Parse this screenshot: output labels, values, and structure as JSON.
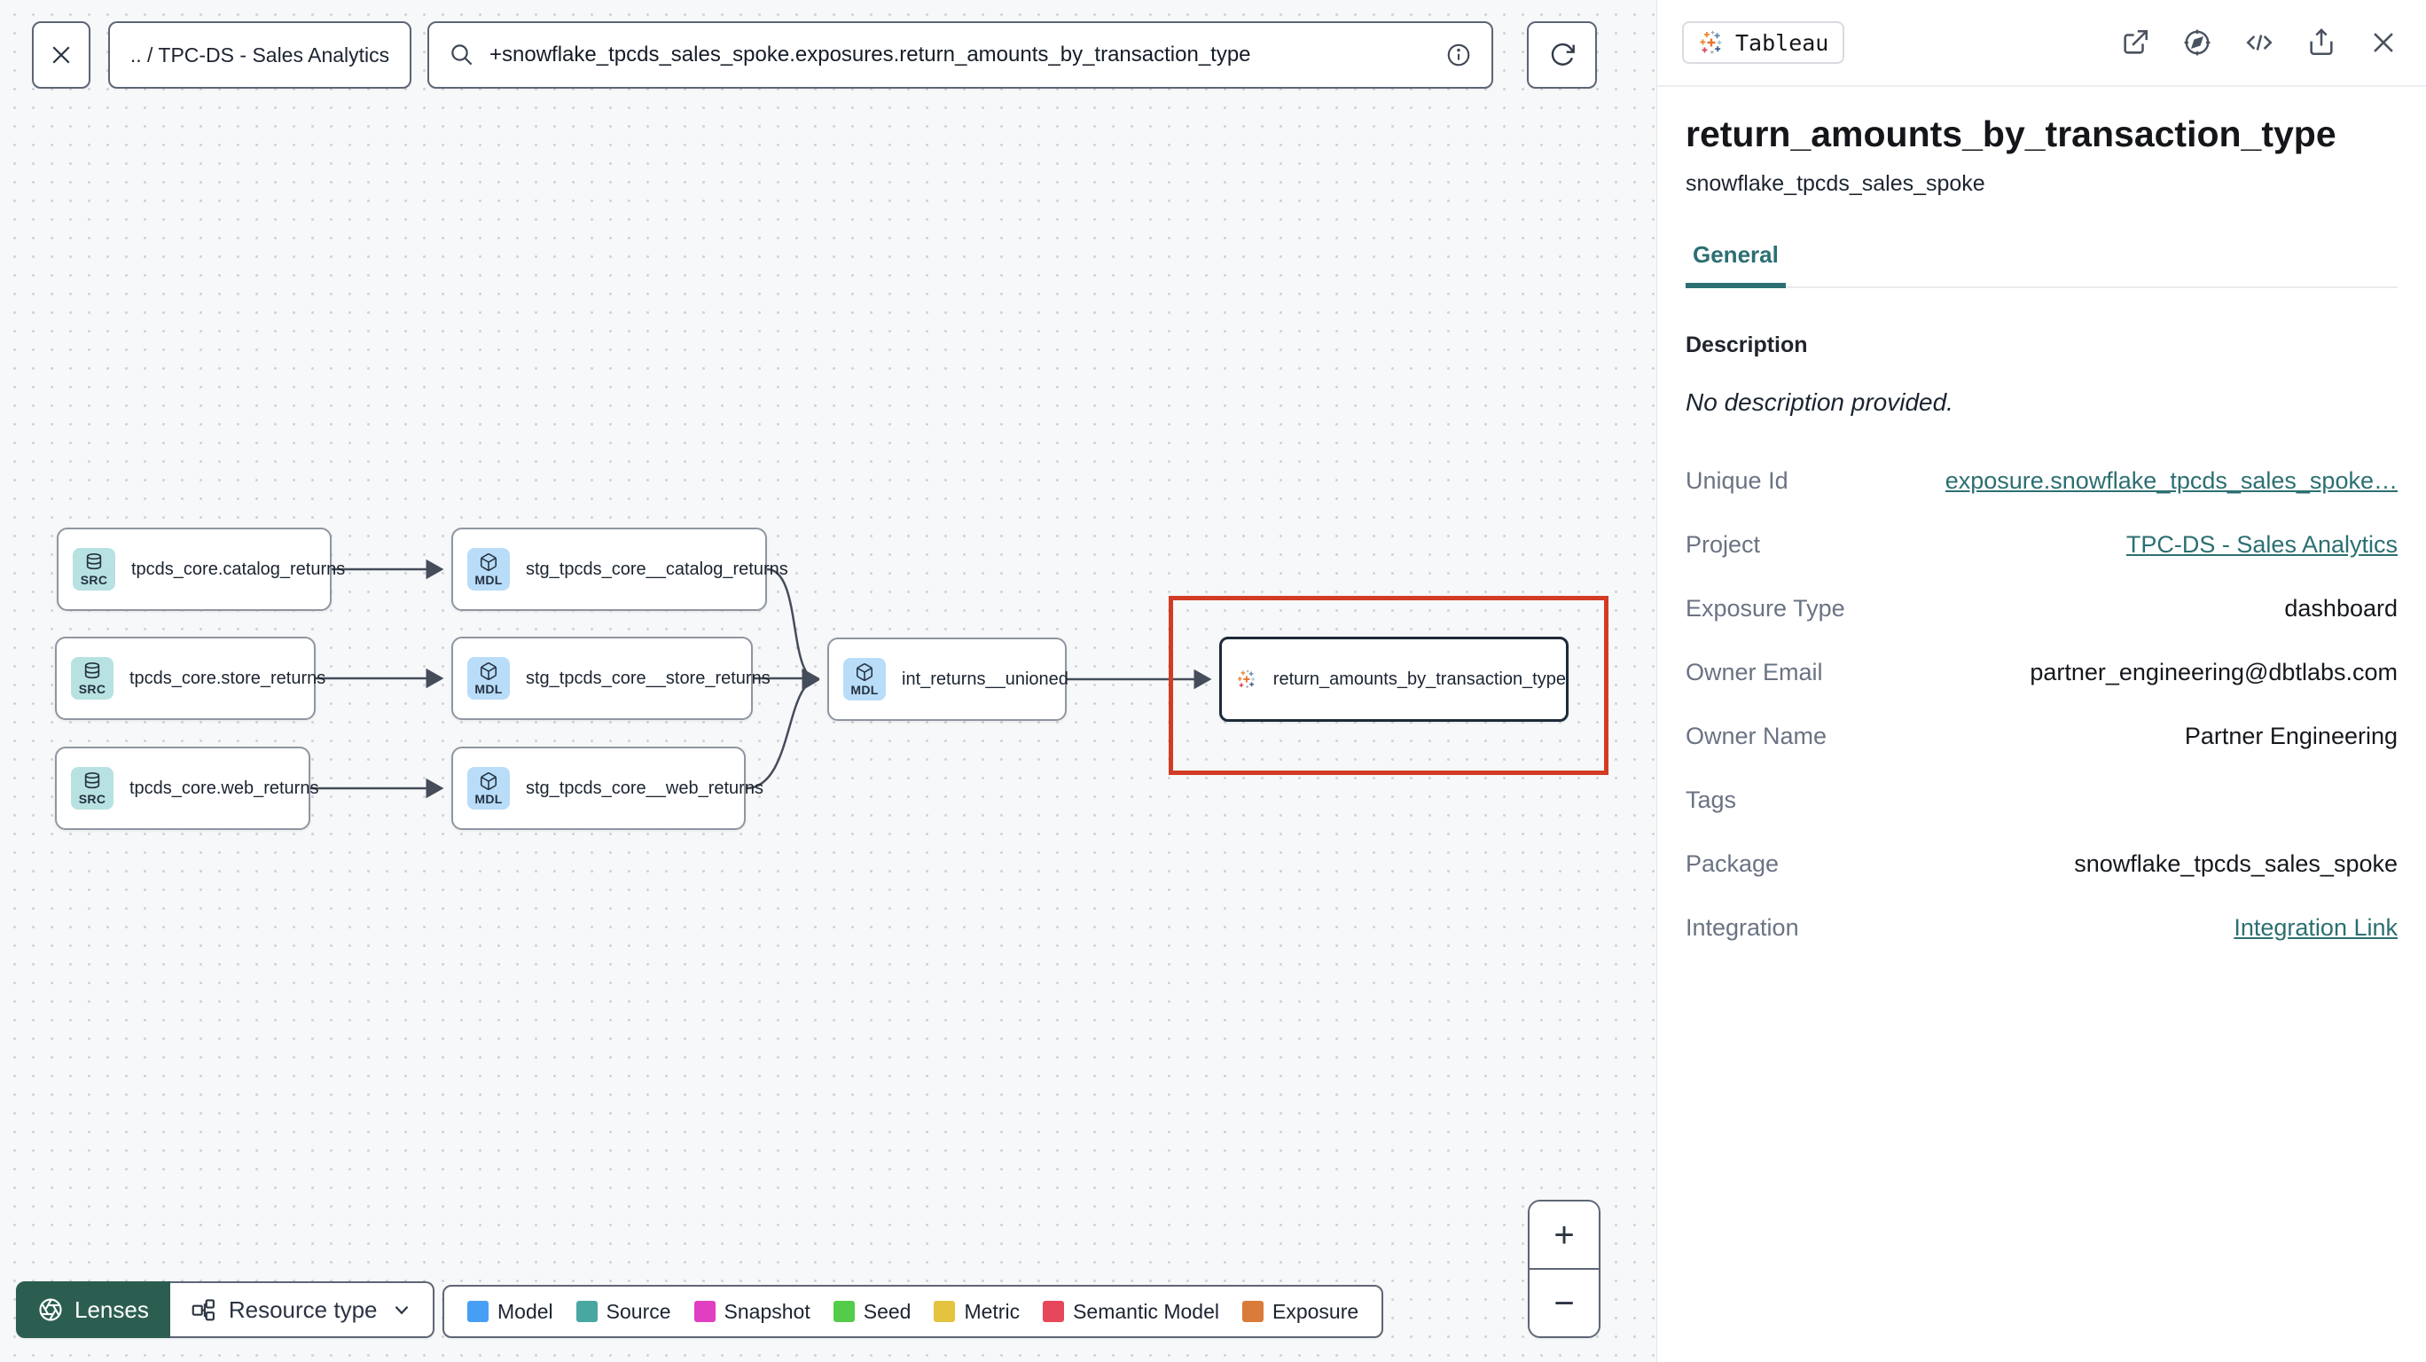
{
  "topbar": {
    "breadcrumb": ".. / TPC-DS - Sales Analytics",
    "search_value": "+snowflake_tpcds_sales_spoke.exposures.return_amounts_by_transaction_type"
  },
  "graph": {
    "nodes": [
      {
        "type": "source",
        "badge": "SRC",
        "label": "tpcds_core.catalog_returns"
      },
      {
        "type": "source",
        "badge": "SRC",
        "label": "tpcds_core.store_returns"
      },
      {
        "type": "source",
        "badge": "SRC",
        "label": "tpcds_core.web_returns"
      },
      {
        "type": "model",
        "badge": "MDL",
        "label": "stg_tpcds_core__catalog_returns"
      },
      {
        "type": "model",
        "badge": "MDL",
        "label": "stg_tpcds_core__store_returns"
      },
      {
        "type": "model",
        "badge": "MDL",
        "label": "stg_tpcds_core__web_returns"
      },
      {
        "type": "model",
        "badge": "MDL",
        "label": "int_returns__unioned"
      },
      {
        "type": "exposure",
        "badge": "tableau",
        "label": "return_amounts_by_transaction_type",
        "selected": true
      }
    ]
  },
  "controls": {
    "lenses_label": "Lenses",
    "resource_type_label": "Resource type",
    "zoom_in": "+",
    "zoom_out": "−"
  },
  "legend": {
    "items": [
      {
        "label": "Model",
        "color": "#479ef5"
      },
      {
        "label": "Source",
        "color": "#49a7a2"
      },
      {
        "label": "Snapshot",
        "color": "#e03fc1"
      },
      {
        "label": "Seed",
        "color": "#54cc49"
      },
      {
        "label": "Metric",
        "color": "#e4c33f"
      },
      {
        "label": "Semantic Model",
        "color": "#e6475a"
      },
      {
        "label": "Exposure",
        "color": "#db7b3a"
      }
    ]
  },
  "panel": {
    "source_badge": "Tableau",
    "title": "return_amounts_by_transaction_type",
    "subtitle": "snowflake_tpcds_sales_spoke",
    "tabs": [
      {
        "label": "General",
        "active": true
      }
    ],
    "description_label": "Description",
    "description_value": "No description provided.",
    "fields": [
      {
        "label": "Unique Id",
        "value": "exposure.snowflake_tpcds_sales_spoke…",
        "link": true
      },
      {
        "label": "Project",
        "value": "TPC-DS - Sales Analytics",
        "link": true
      },
      {
        "label": "Exposure Type",
        "value": "dashboard",
        "link": false
      },
      {
        "label": "Owner Email",
        "value": "partner_engineering@dbtlabs.com",
        "link": false
      },
      {
        "label": "Owner Name",
        "value": "Partner Engineering",
        "link": false
      },
      {
        "label": "Tags",
        "value": "",
        "link": false
      },
      {
        "label": "Package",
        "value": "snowflake_tpcds_sales_spoke",
        "link": false
      },
      {
        "label": "Integration",
        "value": "Integration Link",
        "link": true
      }
    ]
  },
  "colors": {
    "accent_teal": "#2c6f72",
    "selection_red": "#d23b24",
    "lenses_green": "#2b5e51",
    "model_icon_bg": "#b9ddf8",
    "source_icon_bg": "#b7e2e1"
  }
}
